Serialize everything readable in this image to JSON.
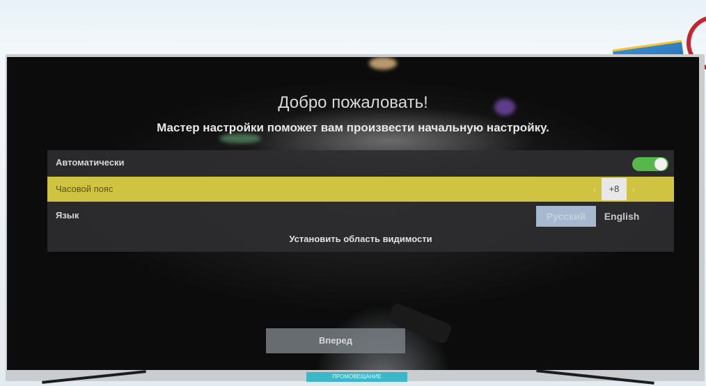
{
  "screen": {
    "title": "Добро пожаловать!",
    "subtitle": "Мастер настройки поможет вам произвести начальную настройку."
  },
  "settings": {
    "auto": {
      "label": "Автоматически",
      "enabled": true
    },
    "timezone": {
      "label": "Часовой пояс",
      "value": "+8",
      "prev_icon": "chevron-left-icon",
      "next_icon": "chevron-right-icon"
    },
    "language": {
      "label": "Язык",
      "options": [
        "Русский",
        "English"
      ],
      "selected": "Русский"
    },
    "region": {
      "label": "Установить область видимости"
    }
  },
  "next_button": {
    "label": "Вперед"
  },
  "promo": {
    "label": "ПРОМОВЕЩАНИЕ"
  },
  "colors": {
    "highlight_row": "#cfc341",
    "toggle_on": "#55b848",
    "panel": "#2e2e30"
  }
}
